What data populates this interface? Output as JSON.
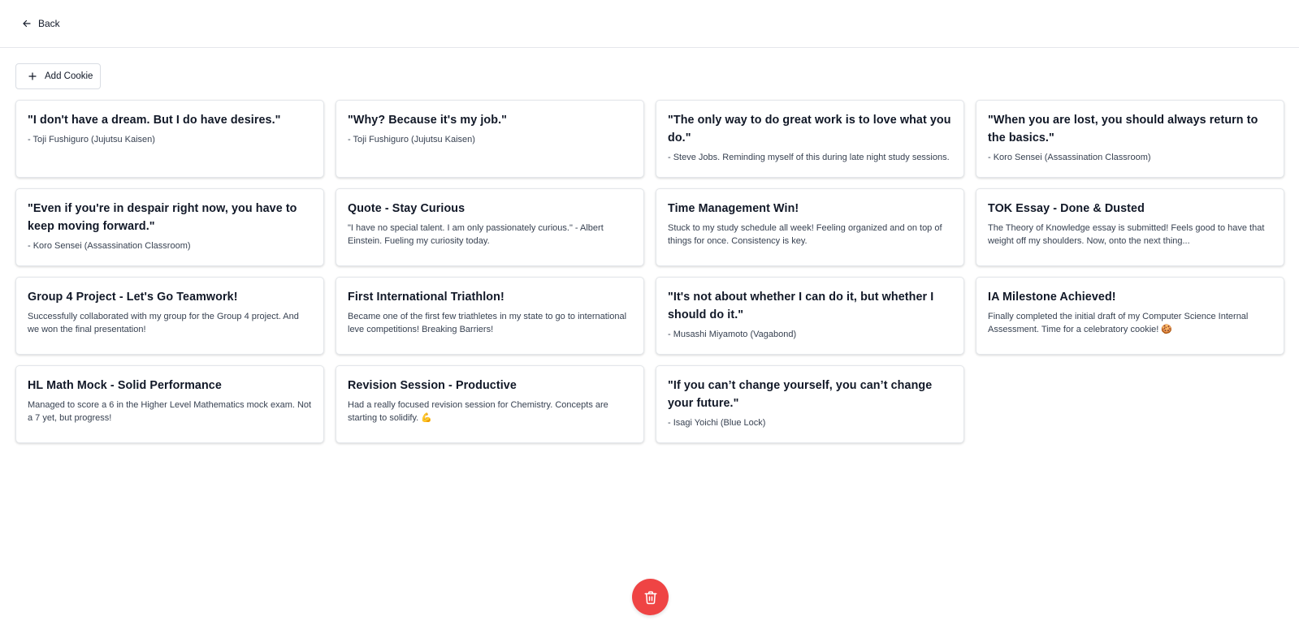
{
  "header": {
    "back_label": "Back",
    "back_icon": "arrow-left-icon"
  },
  "toolbar": {
    "add_label": "Add Cookie",
    "add_icon": "plus-icon"
  },
  "cards": [
    {
      "title": "\"I don't have a dream. But I do have desires.\"",
      "body": "- Toji Fushiguro (Jujutsu Kaisen)"
    },
    {
      "title": "\"Why? Because it's my job.\"",
      "body": "- Toji Fushiguro (Jujutsu Kaisen)"
    },
    {
      "title": "\"The only way to do great work is to love what you do.\"",
      "body": "- Steve Jobs. Reminding myself of this during late night study sessions."
    },
    {
      "title": "\"When you are lost, you should always return to the basics.\"",
      "body": "- Koro Sensei (Assassination Classroom)"
    },
    {
      "title": "\"Even if you're in despair right now, you have to keep moving forward.\"",
      "body": "- Koro Sensei (Assassination Classroom)"
    },
    {
      "title": "Quote - Stay Curious",
      "body": "\"I have no special talent. I am only passionately curious.\" - Albert Einstein. Fueling my curiosity today."
    },
    {
      "title": "Time Management Win!",
      "body": "Stuck to my study schedule all week! Feeling organized and on top of things for once. Consistency is key."
    },
    {
      "title": "TOK Essay - Done & Dusted",
      "body": "The Theory of Knowledge essay is submitted! Feels good to have that weight off my shoulders. Now, onto the next thing..."
    },
    {
      "title": "Group 4 Project - Let's Go Teamwork!",
      "body": "Successfully collaborated with my group for the Group 4 project. And we won the final presentation!"
    },
    {
      "title": "First International Triathlon!",
      "body": "Became one of the first few triathletes in my state to go to international leve competitions! Breaking Barriers!"
    },
    {
      "title": "\"It's not about whether I can do it, but whether I should do it.\"",
      "body": "- Musashi Miyamoto (Vagabond)"
    },
    {
      "title": "IA Milestone Achieved!",
      "body": "Finally completed the initial draft of my Computer Science Internal Assessment. Time for a celebratory cookie! 🍪"
    },
    {
      "title": "HL Math Mock - Solid Performance",
      "body": "Managed to score a 6 in the Higher Level Mathematics mock exam. Not a 7 yet, but progress!"
    },
    {
      "title": "Revision Session - Productive",
      "body": "Had a really focused revision session for Chemistry. Concepts are starting to solidify. 💪"
    },
    {
      "title": "\"If you can’t change yourself, you can’t change your future.\"",
      "body": "- Isagi Yoichi (Blue Lock)"
    }
  ],
  "fab": {
    "icon": "trash-icon",
    "color": "#ef4444"
  }
}
